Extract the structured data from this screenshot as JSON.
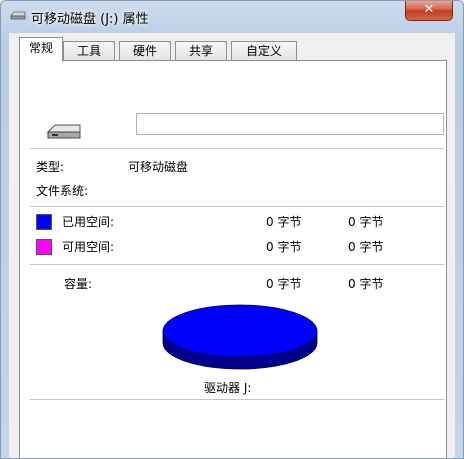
{
  "window": {
    "title": "可移动磁盘 (J:) 属性",
    "close_label": "✕"
  },
  "tabs": [
    {
      "label": "常规"
    },
    {
      "label": "工具"
    },
    {
      "label": "硬件"
    },
    {
      "label": "共享"
    },
    {
      "label": "自定义"
    }
  ],
  "general": {
    "name_value": "",
    "type_label": "类型:",
    "type_value": "可移动磁盘",
    "fs_label": "文件系统:",
    "fs_value": "",
    "used": {
      "label": "已用空间:",
      "bytes": "0 字节",
      "size": "0 字节",
      "color": "#0000ff"
    },
    "free": {
      "label": "可用空间:",
      "bytes": "0 字节",
      "size": "0 字节",
      "color": "#ff00ff"
    },
    "capacity": {
      "label": "容量:",
      "bytes": "0 字节",
      "size": "0 字节"
    },
    "drive_label": "驱动器 J:"
  },
  "icons": {
    "title": "removable-drive-icon",
    "drive": "removable-drive-icon"
  }
}
